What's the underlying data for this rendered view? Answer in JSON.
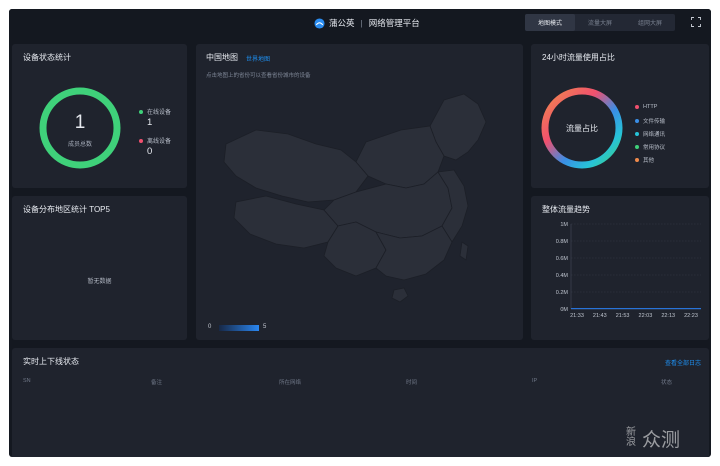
{
  "header": {
    "brand": "蒲公英",
    "app_name": "网络管理平台",
    "tabs": [
      {
        "label": "地图模式",
        "active": true
      },
      {
        "label": "流量大屏",
        "active": false
      },
      {
        "label": "组网大屏",
        "active": false
      }
    ]
  },
  "device_status": {
    "title": "设备状态统计",
    "total": "1",
    "total_label": "成员总数",
    "online_label": "在线设备",
    "online_value": "1",
    "offline_label": "离线设备",
    "offline_value": "0",
    "online_color": "#3fd17a",
    "offline_color": "#f0506e"
  },
  "region": {
    "title": "设备分布地区统计 TOP5",
    "empty_text": "暂无数据"
  },
  "map": {
    "title": "中国地图",
    "world_link": "世界地图",
    "hint": "点击地图上的省份可以查看省份城市的设备",
    "scale_min": "0",
    "scale_max": "5"
  },
  "traffic_share": {
    "title": "24小时流量使用占比",
    "center_label": "流量占比",
    "legend": [
      {
        "label": "HTTP",
        "color": "#f0506e"
      },
      {
        "label": "文件传输",
        "color": "#3a8ee6"
      },
      {
        "label": "网络通讯",
        "color": "#27c3d8"
      },
      {
        "label": "常用协议",
        "color": "#3fd17a"
      },
      {
        "label": "其他",
        "color": "#f08a4b"
      }
    ]
  },
  "trend": {
    "title": "整体流量趋势"
  },
  "chart_data": {
    "type": "line",
    "title": "整体流量趋势",
    "x": [
      "21:33",
      "21:43",
      "21:53",
      "22:03",
      "22:13",
      "22:23"
    ],
    "y_ticks": [
      "0M",
      "0.2M",
      "0.4M",
      "0.6M",
      "0.8M",
      "1M"
    ],
    "ylim": [
      0,
      1
    ],
    "series": [
      {
        "values": [
          0.005,
          0.005,
          0.005,
          0.005,
          0.005,
          0.005
        ],
        "color": "#2a7ff0"
      }
    ],
    "grid": true
  },
  "realtime": {
    "title": "实时上下线状态",
    "log_link": "查看全部日志",
    "columns": [
      "SN",
      "备注",
      "所在网络",
      "时间",
      "IP",
      "状态"
    ]
  },
  "watermark": {
    "small_text": "新浪",
    "big_text": "众测"
  }
}
